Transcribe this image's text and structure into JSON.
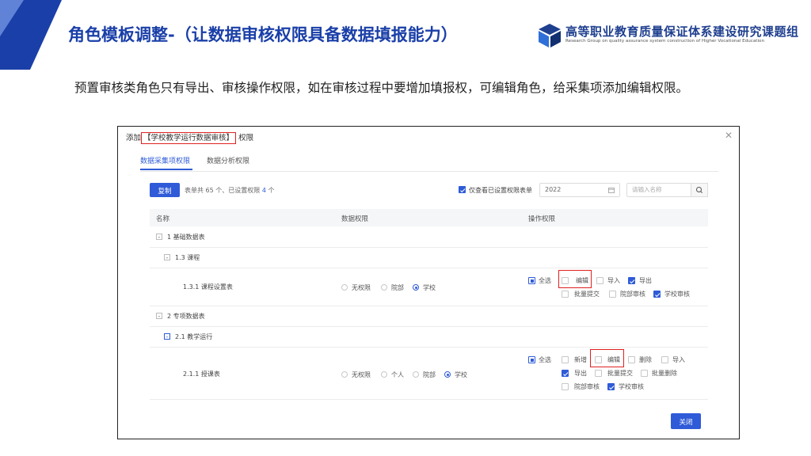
{
  "slide": {
    "title": "角色模板调整-（让数据审核权限具备数据填报能力）",
    "logo_cn": "高等职业教育质量保证体系建设研究课题组",
    "logo_en": "Research Group on quality assurance system construction of Higher Vocational Education",
    "description": "预置审核类角色只有导出、审核操作权限，如在审核过程中要增加填报权，可编辑角色，给采集项添加编辑权限。",
    "accent_color": "#1a3fa8"
  },
  "dialog": {
    "title_prefix": "添加",
    "title_role": "【学校教学运行数据审核】",
    "title_suffix": "权限",
    "tabs": [
      {
        "label": "数据采集项权限",
        "active": true
      },
      {
        "label": "数据分析权限",
        "active": false
      }
    ],
    "copy_label": "复制",
    "summary_prefix": "表单共",
    "summary_total": "65",
    "summary_mid": "个、已设置权限",
    "summary_set": "4",
    "summary_suffix": "个",
    "only_set_label": "仅查看已设置权限表单",
    "only_set_checked": true,
    "year_value": "2022",
    "search_placeholder": "请输入名称",
    "columns": [
      "名称",
      "数据权限",
      "操作权限"
    ],
    "rows": {
      "r1": {
        "label": "1 基础数据表",
        "toggle": "-"
      },
      "r2": {
        "label": "1.3 课程",
        "toggle": "-"
      },
      "r3": {
        "label": "1.3.1 课程设置表",
        "data_perm": [
          "无权限",
          "院部",
          "学校"
        ],
        "data_perm_selected": "学校",
        "ops": [
          {
            "label": "全选",
            "state": "partial"
          },
          {
            "label": "编辑",
            "state": "off",
            "highlight": true
          },
          {
            "label": "导入",
            "state": "off"
          },
          {
            "label": "导出",
            "state": "on"
          },
          {
            "label": "批量提交",
            "state": "off"
          },
          {
            "label": "院部审核",
            "state": "off"
          },
          {
            "label": "学校审核",
            "state": "on"
          }
        ]
      },
      "r4": {
        "label": "2 专项数据表",
        "toggle": "-"
      },
      "r5": {
        "label": "2.1 教学运行",
        "toggle": "-"
      },
      "r6": {
        "label": "2.1.1 授课表",
        "data_perm": [
          "无权限",
          "个人",
          "院部",
          "学校"
        ],
        "data_perm_selected": "学校",
        "ops": [
          {
            "label": "全选",
            "state": "partial"
          },
          {
            "label": "新增",
            "state": "off"
          },
          {
            "label": "编辑",
            "state": "off",
            "highlight": true
          },
          {
            "label": "删除",
            "state": "off"
          },
          {
            "label": "导入",
            "state": "off"
          },
          {
            "label": "导出",
            "state": "on"
          },
          {
            "label": "批量提交",
            "state": "off"
          },
          {
            "label": "批量删除",
            "state": "off"
          },
          {
            "label": "院部审核",
            "state": "off"
          },
          {
            "label": "学校审核",
            "state": "on"
          }
        ]
      }
    },
    "close_label": "关闭",
    "primary_color": "#2f5bd8",
    "highlight_color": "#e02020"
  }
}
